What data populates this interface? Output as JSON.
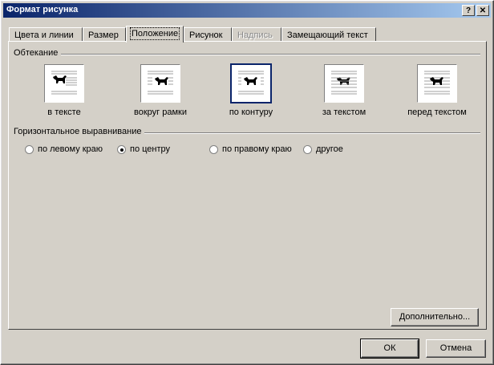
{
  "window": {
    "title": "Формат рисунка",
    "help_label": "?",
    "close_label": "✕"
  },
  "tabs": [
    {
      "label": "Цвета и линии",
      "state": "normal"
    },
    {
      "label": "Размер",
      "state": "normal"
    },
    {
      "label": "Положение",
      "state": "active"
    },
    {
      "label": "Рисунок",
      "state": "normal"
    },
    {
      "label": "Надпись",
      "state": "disabled"
    },
    {
      "label": "Замещающий текст",
      "state": "normal"
    }
  ],
  "wrapping": {
    "title": "Обтекание",
    "options": [
      {
        "label": "в тексте",
        "icon": "wrap-inline-icon",
        "selected": false
      },
      {
        "label": "вокруг рамки",
        "icon": "wrap-square-icon",
        "selected": false
      },
      {
        "label": "по контуру",
        "icon": "wrap-tight-icon",
        "selected": true
      },
      {
        "label": "за текстом",
        "icon": "wrap-behind-icon",
        "selected": false
      },
      {
        "label": "перед текстом",
        "icon": "wrap-front-icon",
        "selected": false
      }
    ]
  },
  "alignment": {
    "title": "Горизонтальное выравнивание",
    "options": [
      {
        "label": "по левому краю",
        "selected": false
      },
      {
        "label": "по центру",
        "selected": true
      },
      {
        "label": "по правому краю",
        "selected": false
      },
      {
        "label": "другое",
        "selected": false
      }
    ]
  },
  "buttons": {
    "advanced": "Дополнительно...",
    "ok": "ОК",
    "cancel": "Отмена"
  }
}
